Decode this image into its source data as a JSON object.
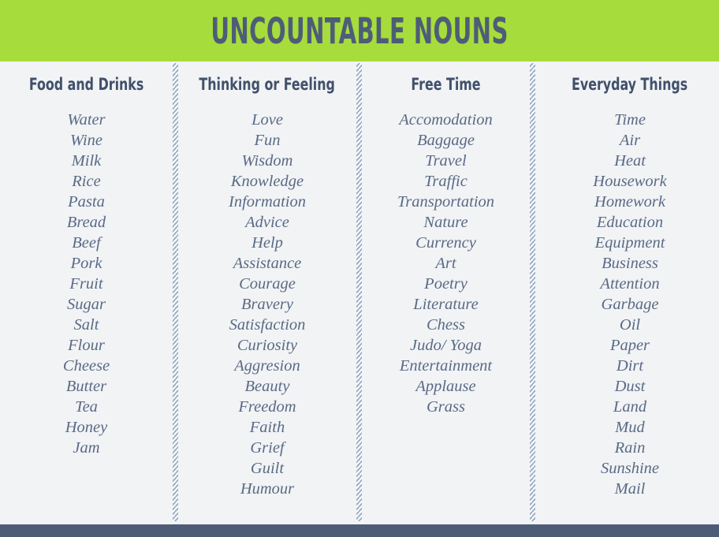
{
  "poster": {
    "title": "UNCOUNTABLE NOUNS",
    "colors": {
      "header_band": "#A6DC3C",
      "title_text": "#4E5D77",
      "page_background": "#F1F3F5",
      "column_header_text": "#41506B",
      "word_text": "#5A6A85",
      "divider_hatch": "#9FB0C6",
      "bottom_bar": "#4E5D77"
    }
  },
  "columns": [
    {
      "header": "Food and Drinks",
      "words": [
        "Water",
        "Wine",
        "Milk",
        "Rice",
        "Pasta",
        "Bread",
        "Beef",
        "Pork",
        "Fruit",
        "Sugar",
        "Salt",
        "Flour",
        "Cheese",
        "Butter",
        "Tea",
        "Honey",
        "Jam"
      ]
    },
    {
      "header": "Thinking or Feeling",
      "words": [
        "Love",
        "Fun",
        "Wisdom",
        "Knowledge",
        "Information",
        "Advice",
        "Help",
        "Assistance",
        "Courage",
        "Bravery",
        "Satisfaction",
        "Curiosity",
        "Aggresion",
        "Beauty",
        "Freedom",
        "Faith",
        "Grief",
        "Guilt",
        "Humour"
      ]
    },
    {
      "header": "Free Time",
      "words": [
        "Accomodation",
        "Baggage",
        "Travel",
        "Traffic",
        "Transportation",
        "Nature",
        "Currency",
        "Art",
        "Poetry",
        "Literature",
        "Chess",
        "Judo/ Yoga",
        "Entertainment",
        "Applause",
        "Grass"
      ]
    },
    {
      "header": "Everyday Things",
      "words": [
        "Time",
        "Air",
        "Heat",
        "Housework",
        "Homework",
        "Education",
        "Equipment",
        "Business",
        "Attention",
        "Garbage",
        "Oil",
        "Paper",
        "Dirt",
        "Dust",
        "Land",
        "Mud",
        "Rain",
        "Sunshine",
        "Mail"
      ]
    }
  ]
}
